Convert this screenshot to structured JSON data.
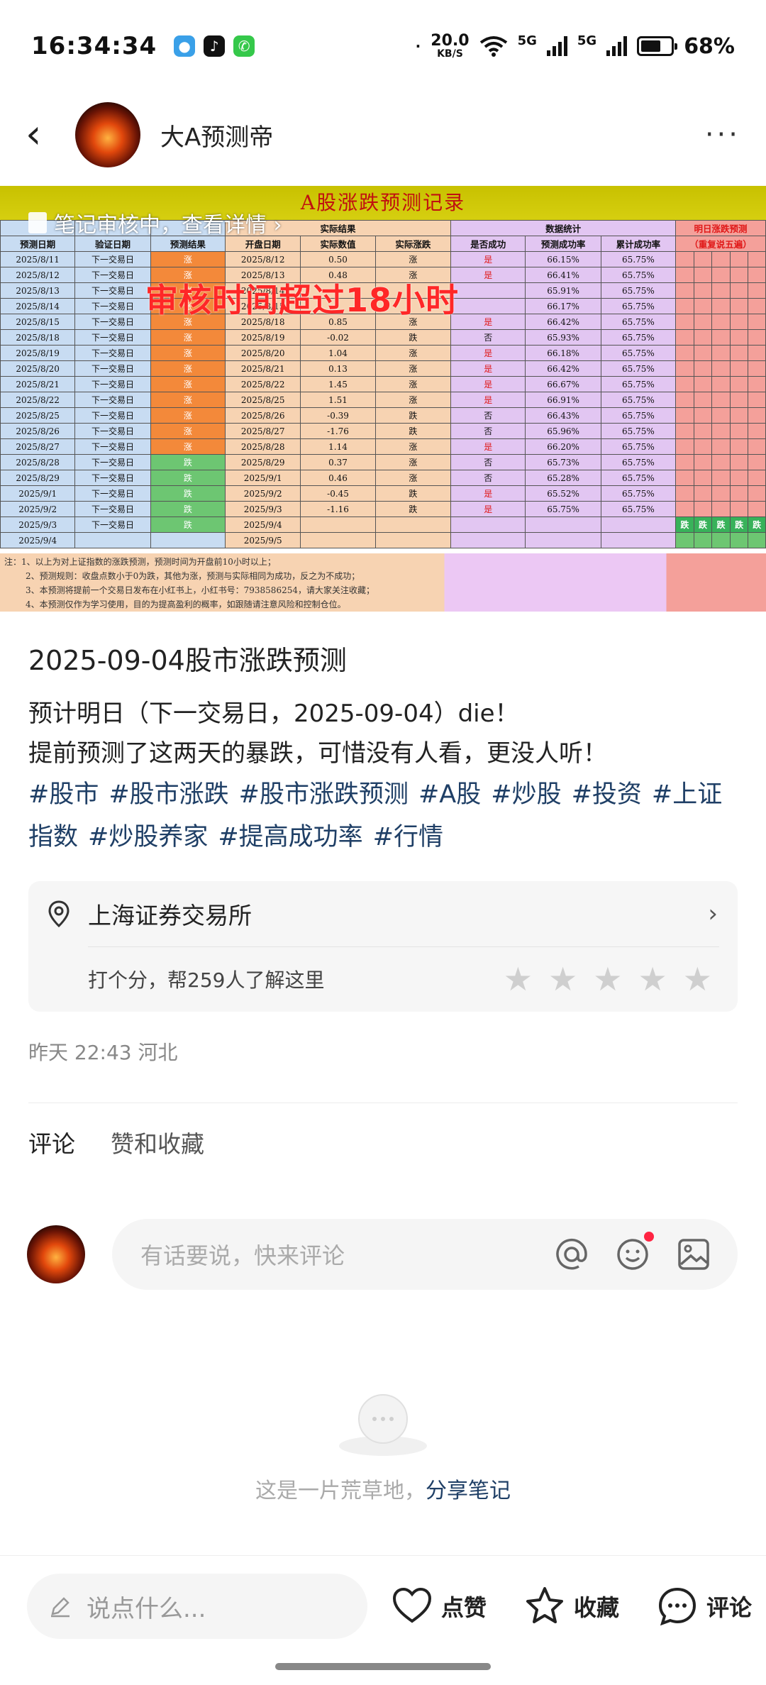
{
  "status_bar": {
    "time": "16:34:34",
    "speed_value": "20.0",
    "speed_unit": "KB/S",
    "net1": "5G",
    "net2": "5G",
    "battery": "68%",
    "battery_level": 0.68
  },
  "header": {
    "author_name": "大A预测帝"
  },
  "post_image": {
    "sheet_title": "A股涨跌预测记录",
    "audit_banner": "笔记审核中，查看详情 ›",
    "stamp_text": "审核时间超过18小时",
    "group_headers": [
      "实际结果",
      "数据统计",
      "明日涨跌预测"
    ],
    "col_headers": [
      "预测日期",
      "验证日期",
      "预测结果",
      "开盘日期",
      "实际数值",
      "实际涨跌",
      "是否成功",
      "预测成功率",
      "累计成功率",
      "（重复说五遍）"
    ],
    "rows": [
      [
        "2025/8/11",
        "下一交易日",
        "涨",
        "2025/8/12",
        "0.50",
        "涨",
        "是",
        "66.15%",
        "65.75%"
      ],
      [
        "2025/8/12",
        "下一交易日",
        "涨",
        "2025/8/13",
        "0.48",
        "涨",
        "是",
        "66.41%",
        "65.75%"
      ],
      [
        "2025/8/13",
        "下一交易日",
        "涨",
        "2025/8/14",
        "",
        "",
        "",
        "65.91%",
        "65.75%"
      ],
      [
        "2025/8/14",
        "下一交易日",
        "涨",
        "2025/8/15",
        "",
        "",
        "",
        "66.17%",
        "65.75%"
      ],
      [
        "2025/8/15",
        "下一交易日",
        "涨",
        "2025/8/18",
        "0.85",
        "涨",
        "是",
        "66.42%",
        "65.75%"
      ],
      [
        "2025/8/18",
        "下一交易日",
        "涨",
        "2025/8/19",
        "-0.02",
        "跌",
        "否",
        "65.93%",
        "65.75%"
      ],
      [
        "2025/8/19",
        "下一交易日",
        "涨",
        "2025/8/20",
        "1.04",
        "涨",
        "是",
        "66.18%",
        "65.75%"
      ],
      [
        "2025/8/20",
        "下一交易日",
        "涨",
        "2025/8/21",
        "0.13",
        "涨",
        "是",
        "66.42%",
        "65.75%"
      ],
      [
        "2025/8/21",
        "下一交易日",
        "涨",
        "2025/8/22",
        "1.45",
        "涨",
        "是",
        "66.67%",
        "65.75%"
      ],
      [
        "2025/8/22",
        "下一交易日",
        "涨",
        "2025/8/25",
        "1.51",
        "涨",
        "是",
        "66.91%",
        "65.75%"
      ],
      [
        "2025/8/25",
        "下一交易日",
        "涨",
        "2025/8/26",
        "-0.39",
        "跌",
        "否",
        "66.43%",
        "65.75%"
      ],
      [
        "2025/8/26",
        "下一交易日",
        "涨",
        "2025/8/27",
        "-1.76",
        "跌",
        "否",
        "65.96%",
        "65.75%"
      ],
      [
        "2025/8/27",
        "下一交易日",
        "涨",
        "2025/8/28",
        "1.14",
        "涨",
        "是",
        "66.20%",
        "65.75%"
      ],
      [
        "2025/8/28",
        "下一交易日",
        "跌",
        "2025/8/29",
        "0.37",
        "涨",
        "否",
        "65.73%",
        "65.75%"
      ],
      [
        "2025/8/29",
        "下一交易日",
        "跌",
        "2025/9/1",
        "0.46",
        "涨",
        "否",
        "65.28%",
        "65.75%"
      ],
      [
        "2025/9/1",
        "下一交易日",
        "跌",
        "2025/9/2",
        "-0.45",
        "跌",
        "是",
        "65.52%",
        "65.75%"
      ],
      [
        "2025/9/2",
        "下一交易日",
        "跌",
        "2025/9/3",
        "-1.16",
        "跌",
        "是",
        "65.75%",
        "65.75%"
      ],
      [
        "2025/9/3",
        "下一交易日",
        "跌",
        "2025/9/4",
        "",
        "",
        "",
        "",
        ""
      ],
      [
        "2025/9/4",
        "",
        "",
        "2025/9/5",
        "",
        "",
        "",
        "",
        ""
      ]
    ],
    "tomorrow_prediction": [
      "跌",
      "跌",
      "跌",
      "跌",
      "跌"
    ],
    "notes": [
      "注：1、以上为对上证指数的涨跌预测，预测时间为开盘前10小时以上；",
      "2、预测规则：收盘点数小于0为跌，其他为涨，预测与实际相同为成功，反之为不成功；",
      "3、本预测将提前一个交易日发布在小红书上，小红书号：7938586254，请大家关注收藏；",
      "4、本预测仅作为学习使用，目的为提高盈利的概率，如跟随请注意风险和控制仓位。"
    ]
  },
  "post": {
    "title": "2025-09-04股市涨跌预测",
    "line1": "预计明日（下一交易日，2025-09-04）die！",
    "line2": "提前预测了这两天的暴跌，可惜没有人看，更没人听！",
    "tags": [
      "#股市",
      "#股市涨跌",
      "#股市涨跌预测",
      "#A股",
      "#炒股",
      "#投资",
      "#上证指数",
      "#炒股养家",
      "#提高成功率",
      "#行情"
    ]
  },
  "location": {
    "name": "上海证券交易所",
    "rate_prompt": "打个分，帮259人了解这里",
    "stars": 5
  },
  "meta": {
    "time_place": "昨天 22:43 河北"
  },
  "tabs": {
    "comments": "评论",
    "likes": "赞和收藏"
  },
  "comment_input": {
    "placeholder": "有话要说，快来评论"
  },
  "empty_state": {
    "text": "这是一片荒草地，",
    "link": "分享笔记"
  },
  "bottom_bar": {
    "say_placeholder": "说点什么...",
    "like_label": "点赞",
    "collect_label": "收藏",
    "comment_label": "评论"
  },
  "colors": {
    "tag_blue": "#1f3f66",
    "accent_red": "#ff2442",
    "stamp_red": "#ff2727"
  }
}
